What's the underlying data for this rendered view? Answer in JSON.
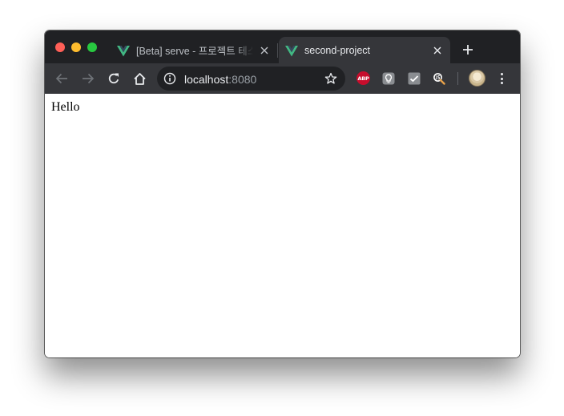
{
  "tabs": [
    {
      "title": "[Beta] serve - 프로젝트 테스트",
      "favicon": "vue-logo-icon",
      "active": false
    },
    {
      "title": "second-project",
      "favicon": "vue-logo-icon",
      "active": true
    }
  ],
  "address_bar": {
    "host": "localhost",
    "port": ":8080"
  },
  "extensions": {
    "adblock_label": "ABP"
  },
  "page": {
    "text": "Hello"
  },
  "colors": {
    "tabstrip": "#202124",
    "toolbar": "#35363a",
    "vue_green": "#42b883",
    "vue_dark": "#35495e"
  }
}
